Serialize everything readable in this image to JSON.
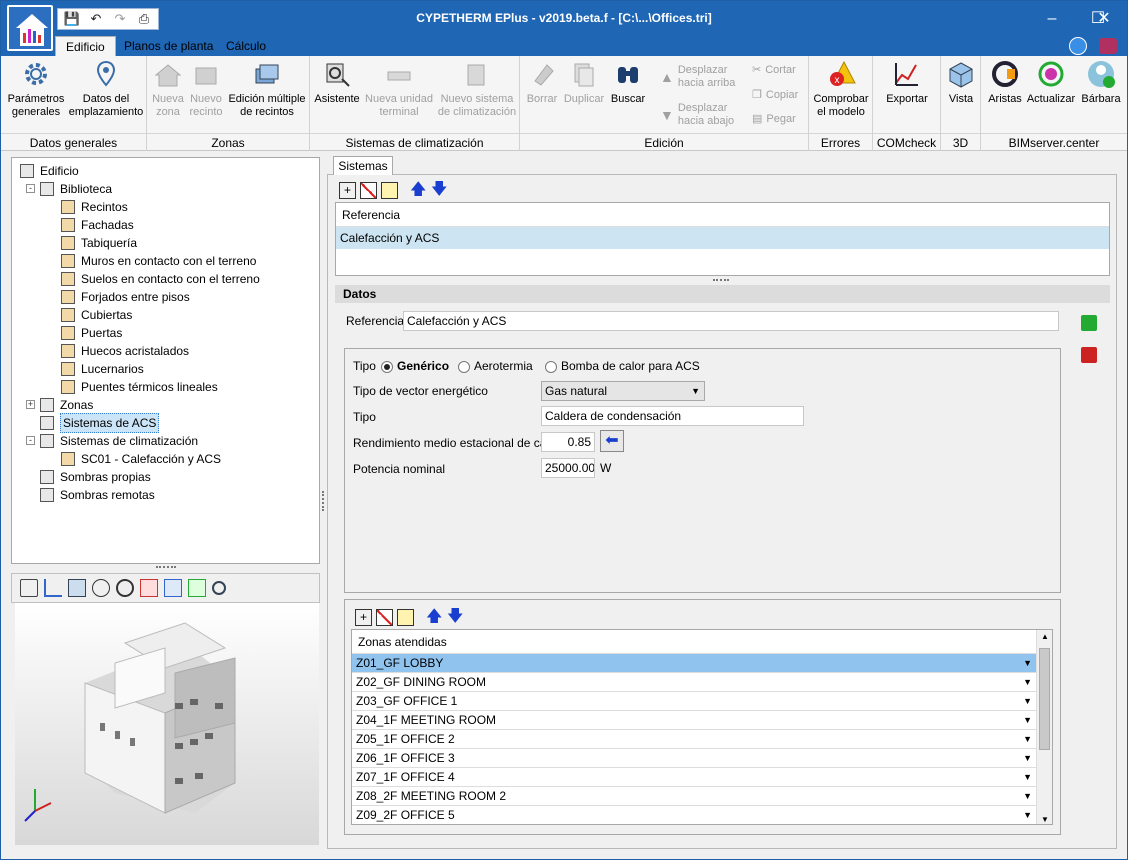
{
  "window": {
    "title": "CYPETHERM EPlus - v2019.beta.f - [C:\\...\\Offices.tri]",
    "qat_icons": [
      "save-icon",
      "undo-icon",
      "redo-icon",
      "print-icon"
    ]
  },
  "ribbon_tabs": [
    {
      "label": "Edificio",
      "active": true
    },
    {
      "label": "Planos de planta",
      "active": false
    },
    {
      "label": "Cálculo",
      "active": false
    }
  ],
  "ribbon": {
    "datos_generales": {
      "name": "Datos generales",
      "parametros": "Parámetros generales",
      "parametros_l1": "Parámetros",
      "parametros_l2": "generales",
      "datos_l1": "Datos del",
      "datos_l2": "emplazamiento"
    },
    "zonas": {
      "name": "Zonas",
      "nueva_l1": "Nueva",
      "nueva_l2": "zona",
      "nuevo_l1": "Nuevo",
      "nuevo_l2": "recinto",
      "edicion_l1": "Edición múltiple",
      "edicion_l2": "de recintos"
    },
    "sistemas": {
      "name": "Sistemas de climatización",
      "asistente": "Asistente",
      "unidad_l1": "Nueva unidad",
      "unidad_l2": "terminal",
      "sistema_l1": "Nuevo sistema",
      "sistema_l2": "de climatización"
    },
    "edicion": {
      "name": "Edición",
      "borrar": "Borrar",
      "duplicar": "Duplicar",
      "buscar": "Buscar",
      "arriba_l1": "Desplazar",
      "arriba_l2": "hacia arriba",
      "abajo_l1": "Desplazar",
      "abajo_l2": "hacia abajo",
      "cortar": "Cortar",
      "copiar": "Copiar",
      "pegar": "Pegar"
    },
    "errores": {
      "name": "Errores",
      "l1": "Comprobar",
      "l2": "el modelo"
    },
    "comcheck": {
      "name": "COMcheck",
      "exportar": "Exportar"
    },
    "tresd": {
      "name": "3D",
      "vista": "Vista"
    },
    "bim": {
      "name": "BIMserver.center",
      "aristas": "Aristas",
      "actualizar": "Actualizar",
      "barbara": "Bárbara"
    }
  },
  "tree": [
    {
      "label": "Edificio",
      "level": 0,
      "icon": "building-icon"
    },
    {
      "label": "Biblioteca",
      "level": 1,
      "icon": "library-icon"
    },
    {
      "label": "Recintos",
      "level": 2,
      "icon": "room-icon"
    },
    {
      "label": "Fachadas",
      "level": 2,
      "icon": "facade-icon"
    },
    {
      "label": "Tabiquería",
      "level": 2,
      "icon": "partition-icon"
    },
    {
      "label": "Muros en contacto con el terreno",
      "level": 2,
      "icon": "wall-ground-icon"
    },
    {
      "label": "Suelos en contacto con el terreno",
      "level": 2,
      "icon": "floor-ground-icon"
    },
    {
      "label": "Forjados entre pisos",
      "level": 2,
      "icon": "slab-icon"
    },
    {
      "label": "Cubiertas",
      "level": 2,
      "icon": "roof-icon"
    },
    {
      "label": "Puertas",
      "level": 2,
      "icon": "door-icon"
    },
    {
      "label": "Huecos acristalados",
      "level": 2,
      "icon": "window-icon"
    },
    {
      "label": "Lucernarios",
      "level": 2,
      "icon": "skylight-icon"
    },
    {
      "label": "Puentes térmicos lineales",
      "level": 2,
      "icon": "thermal-bridge-icon"
    },
    {
      "label": "Zonas",
      "level": 1,
      "icon": "house-icon"
    },
    {
      "label": "Sistemas de ACS",
      "level": 1,
      "icon": "tap-icon",
      "selected": true
    },
    {
      "label": "Sistemas de climatización",
      "level": 1,
      "icon": "hvac-icon"
    },
    {
      "label": "SC01 - Calefacción y ACS",
      "level": 2,
      "icon": "drop-icon"
    },
    {
      "label": "Sombras propias",
      "level": 1,
      "icon": "shadow-icon"
    },
    {
      "label": "Sombras remotas",
      "level": 1,
      "icon": "shadow-icon"
    }
  ],
  "sistemas_tab": "Sistemas",
  "ref_table": {
    "header": "Referencia",
    "rows": [
      "Calefacción y ACS"
    ]
  },
  "datos": {
    "header": "Datos",
    "referencia_label": "Referencia",
    "referencia_value": "Calefacción y ACS",
    "tipo_label": "Tipo",
    "tipo_options": [
      "Genérico",
      "Aerotermia",
      "Bomba de calor para ACS"
    ],
    "tipo_selected": "Genérico",
    "vector_label": "Tipo de vector energético",
    "vector_value": "Gas natural",
    "tipo2_label": "Tipo",
    "tipo2_value": "Caldera de condensación",
    "rendimiento_label": "Rendimiento medio estacional de calor",
    "rendimiento_value": "0.85",
    "potencia_label": "Potencia nominal",
    "potencia_value": "25000.00",
    "potencia_unit": "W"
  },
  "zonas": {
    "header": "Zonas atendidas",
    "rows": [
      "Z01_GF LOBBY",
      "Z02_GF DINING ROOM",
      "Z03_GF OFFICE 1",
      "Z04_1F MEETING ROOM",
      "Z05_1F OFFICE 2",
      "Z06_1F OFFICE 3",
      "Z07_1F OFFICE 4",
      "Z08_2F MEETING ROOM 2",
      "Z09_2F OFFICE 5"
    ],
    "selected_index": 0
  }
}
